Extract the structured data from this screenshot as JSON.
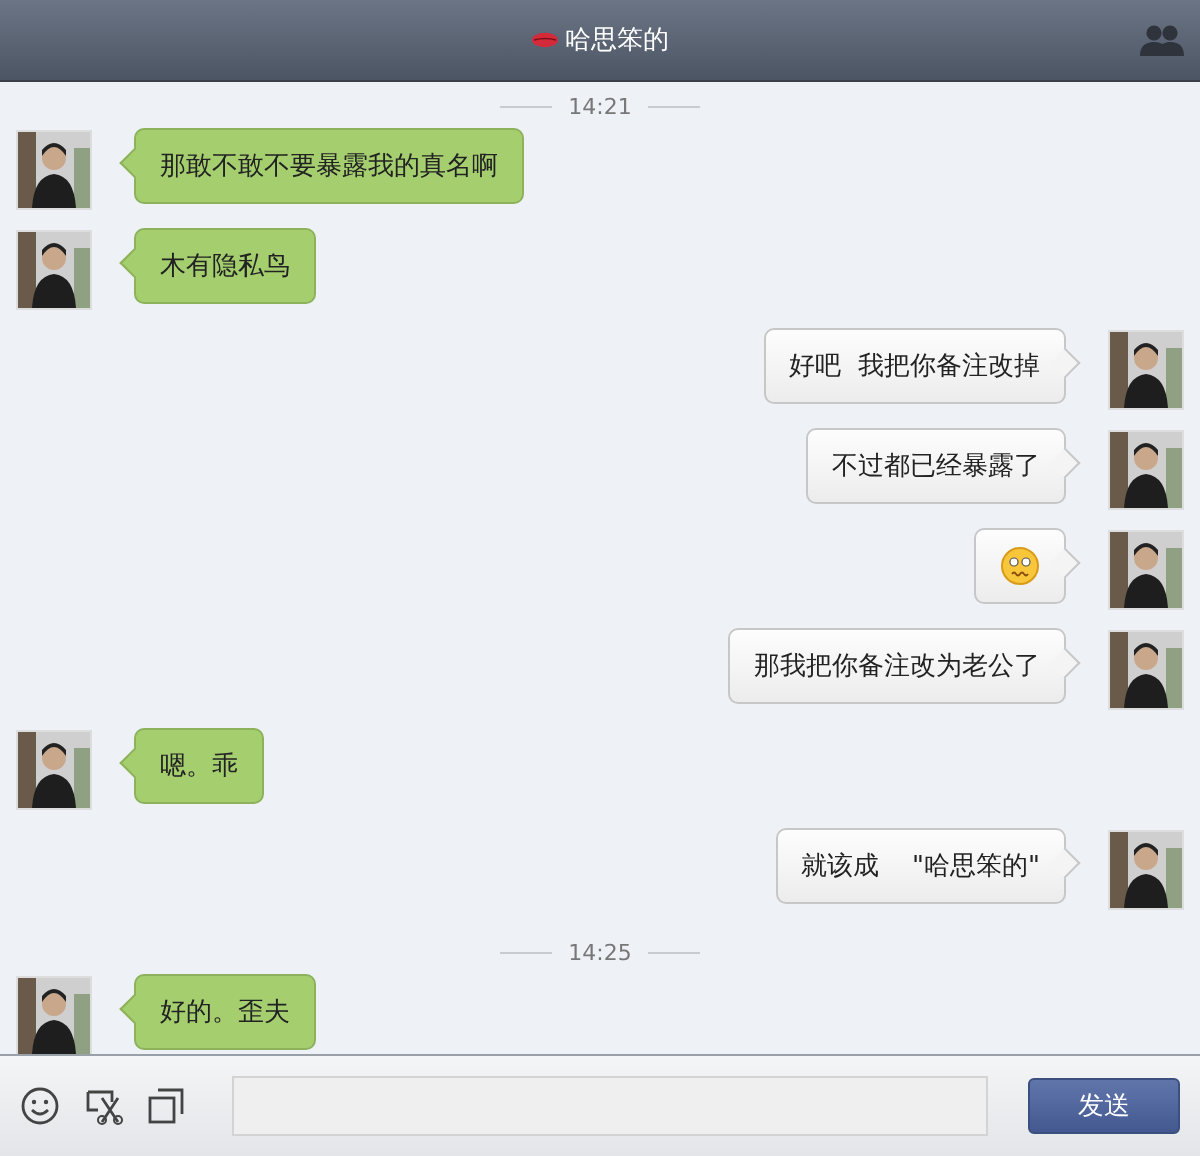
{
  "header": {
    "title": "哈思笨的"
  },
  "messages": [
    {
      "kind": "time",
      "text": "14:21"
    },
    {
      "kind": "text",
      "outgoing": false,
      "text": "那敢不敢不要暴露我的真名啊"
    },
    {
      "kind": "text",
      "outgoing": false,
      "text": "木有隐私鸟"
    },
    {
      "kind": "text",
      "outgoing": true,
      "text": "好吧  我把你备注改掉"
    },
    {
      "kind": "text",
      "outgoing": true,
      "text": "不过都已经暴露了"
    },
    {
      "kind": "emoji",
      "outgoing": true
    },
    {
      "kind": "text",
      "outgoing": true,
      "text": "那我把你备注改为老公了"
    },
    {
      "kind": "text",
      "outgoing": false,
      "text": "嗯。乖"
    },
    {
      "kind": "text",
      "outgoing": true,
      "text": "就该成    \"哈思笨的\""
    },
    {
      "kind": "time",
      "text": "14:25"
    },
    {
      "kind": "text",
      "outgoing": false,
      "text": "好的。歪夫"
    }
  ],
  "composer": {
    "send_label": "发送"
  }
}
